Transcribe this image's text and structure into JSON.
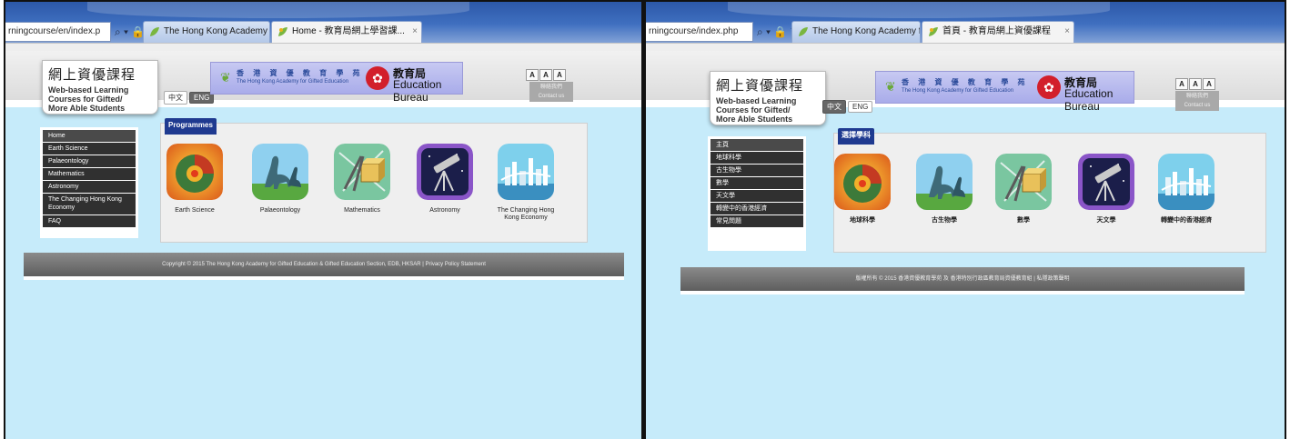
{
  "panels": [
    {
      "address": "rningcourse/en/index.p",
      "address_controls": "⌕ ▾ 🔒 ↻",
      "tab_inactive": "The Hong Kong Academy for ...",
      "tab_active": "Home - 教育局網上學習課...",
      "tab_close": "×",
      "logo": {
        "zh": "網上資優課程",
        "en_line1": "Web-based Learning",
        "en_line2": "Courses for Gifted/",
        "en_line3": "More Able Students"
      },
      "lang_zh": "中文",
      "lang_en": "ENG",
      "active_lang": "en",
      "banner": {
        "hka_zh": "香 港 資 優 教 育 學 苑",
        "hka_en": "The Hong Kong Academy for Gifted Education",
        "edb_zh": "教育局",
        "edb_en": "Education Bureau",
        "emblem": "✿"
      },
      "font_buttons": [
        "A",
        "A",
        "A"
      ],
      "contact_zh": "聯絡我們",
      "contact_en": "Contact us",
      "menu": [
        {
          "label": "Home",
          "active": true
        },
        {
          "label": "Earth Science"
        },
        {
          "label": "Palaeontology"
        },
        {
          "label": "Mathematics"
        },
        {
          "label": "Astronomy"
        },
        {
          "label": "The Changing Hong Kong Economy",
          "two": true
        },
        {
          "label": "FAQ"
        }
      ],
      "programmes_title": "Programmes",
      "programmes": [
        {
          "label": "Earth Science",
          "icon": "earth-science-icon"
        },
        {
          "label": "Palaeontology",
          "icon": "dinosaur-icon"
        },
        {
          "label": "Mathematics",
          "icon": "mathematics-icon"
        },
        {
          "label": "Astronomy",
          "icon": "telescope-icon"
        },
        {
          "label": "The Changing Hong Kong Economy",
          "icon": "skyline-icon"
        }
      ],
      "footer": "Copyright © 2015 The Hong Kong Academy for Gifted Education & Gifted Education Section, EDB, HKSAR | Privacy Policy Statement"
    },
    {
      "address": "rningcourse/index.php",
      "address_controls": "⌕ ▾ 🔒 ↻",
      "tab_inactive": "The Hong Kong Academy for ...",
      "tab_active": "首頁 - 教育局網上資優課程",
      "tab_close": "×",
      "logo": {
        "zh": "網上資優課程",
        "en_line1": "Web-based Learning",
        "en_line2": "Courses for Gifted/",
        "en_line3": "More Able Students"
      },
      "lang_zh": "中文",
      "lang_en": "ENG",
      "active_lang": "zh",
      "banner": {
        "hka_zh": "香 港 資 優 教 育 學 苑",
        "hka_en": "The Hong Kong Academy for Gifted Education",
        "edb_zh": "教育局",
        "edb_en": "Education Bureau",
        "emblem": "✿"
      },
      "font_buttons": [
        "A",
        "A",
        "A"
      ],
      "contact_zh": "聯絡我們",
      "contact_en": "Contact us",
      "menu": [
        {
          "label": "主頁",
          "active": true
        },
        {
          "label": "地球科學"
        },
        {
          "label": "古生物學"
        },
        {
          "label": "數學"
        },
        {
          "label": "天文學"
        },
        {
          "label": "轉變中的香港經濟"
        },
        {
          "label": "常見問題"
        }
      ],
      "programmes_title": "選擇學科",
      "programmes": [
        {
          "label": "地球科學",
          "icon": "earth-science-icon"
        },
        {
          "label": "古生物學",
          "icon": "dinosaur-icon"
        },
        {
          "label": "數學",
          "icon": "mathematics-icon"
        },
        {
          "label": "天文學",
          "icon": "telescope-icon"
        },
        {
          "label": "轉變中的香港經濟",
          "icon": "skyline-icon"
        }
      ],
      "footer": "版權所有 © 2015 香港資優教育學苑 及 香港特別行政區教育局資優教育組 | 私隱政策聲明"
    }
  ],
  "colors": {
    "page_bg": "#c6ebfa",
    "menu_bg": "#303030",
    "programmes_tab": "#1f3a90",
    "footer_bg": "#6e6e6e",
    "edb_red": "#d21f2b"
  }
}
